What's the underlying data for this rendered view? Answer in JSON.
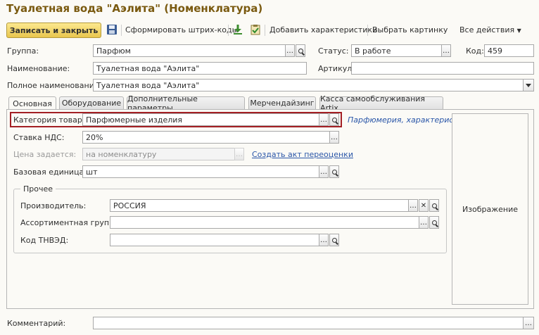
{
  "window": {
    "title": "Туалетная вода \"Аэлита\" (Номенклатура)"
  },
  "toolbar": {
    "save_close": "Записать и закрыть",
    "barcode": "Сформировать штрих-коды",
    "add_characteristics": "Добавить характеристики",
    "pick_image": "Выбрать картинку",
    "all_actions": "Все действия"
  },
  "header": {
    "group_label": "Группа:",
    "group_value": "Парфюм",
    "status_label": "Статус:",
    "status_value": "В работе",
    "code_label": "Код:",
    "code_value": "459",
    "name_label": "Наименование:",
    "name_value": "Туалетная вода \"Аэлита\"",
    "article_label": "Артикул:",
    "article_value": "",
    "full_name_label": "Полное наименование:",
    "full_name_value": "Туалетная вода \"Аэлита\""
  },
  "tabs": [
    {
      "label": "Основная",
      "active": true
    },
    {
      "label": "Оборудование",
      "active": false
    },
    {
      "label": "Дополнительные параметры",
      "active": false
    },
    {
      "label": "Мерчендайзинг",
      "active": false
    },
    {
      "label": "Касса самообслуживания Artix",
      "active": false
    }
  ],
  "main": {
    "category_label": "Категория товара:",
    "category_value": "Парфюмерные изделия",
    "category_link": "Парфюмерия, характерис...",
    "vat_label": "Ставка НДС:",
    "vat_value": "20%",
    "price_label": "Цена задается:",
    "price_value": "на номенклатуру",
    "repricing_link": "Создать акт переоценки",
    "unit_label": "Базовая единица:",
    "unit_value": "шт",
    "other_group_title": "Прочее",
    "manufacturer_label": "Производитель:",
    "manufacturer_value": "РОССИЯ",
    "assortment_label": "Ассортиментная группа:",
    "assortment_value": "",
    "tnved_label": "Код ТНВЭД:",
    "tnved_value": "",
    "image_label": "Изображение"
  },
  "footer": {
    "comment_label": "Комментарий:",
    "comment_value": ""
  },
  "colors": {
    "title": "#7a5a10",
    "primary_button": "#f4d86a",
    "highlight_border": "#a31f24",
    "link": "#2a56a8"
  }
}
